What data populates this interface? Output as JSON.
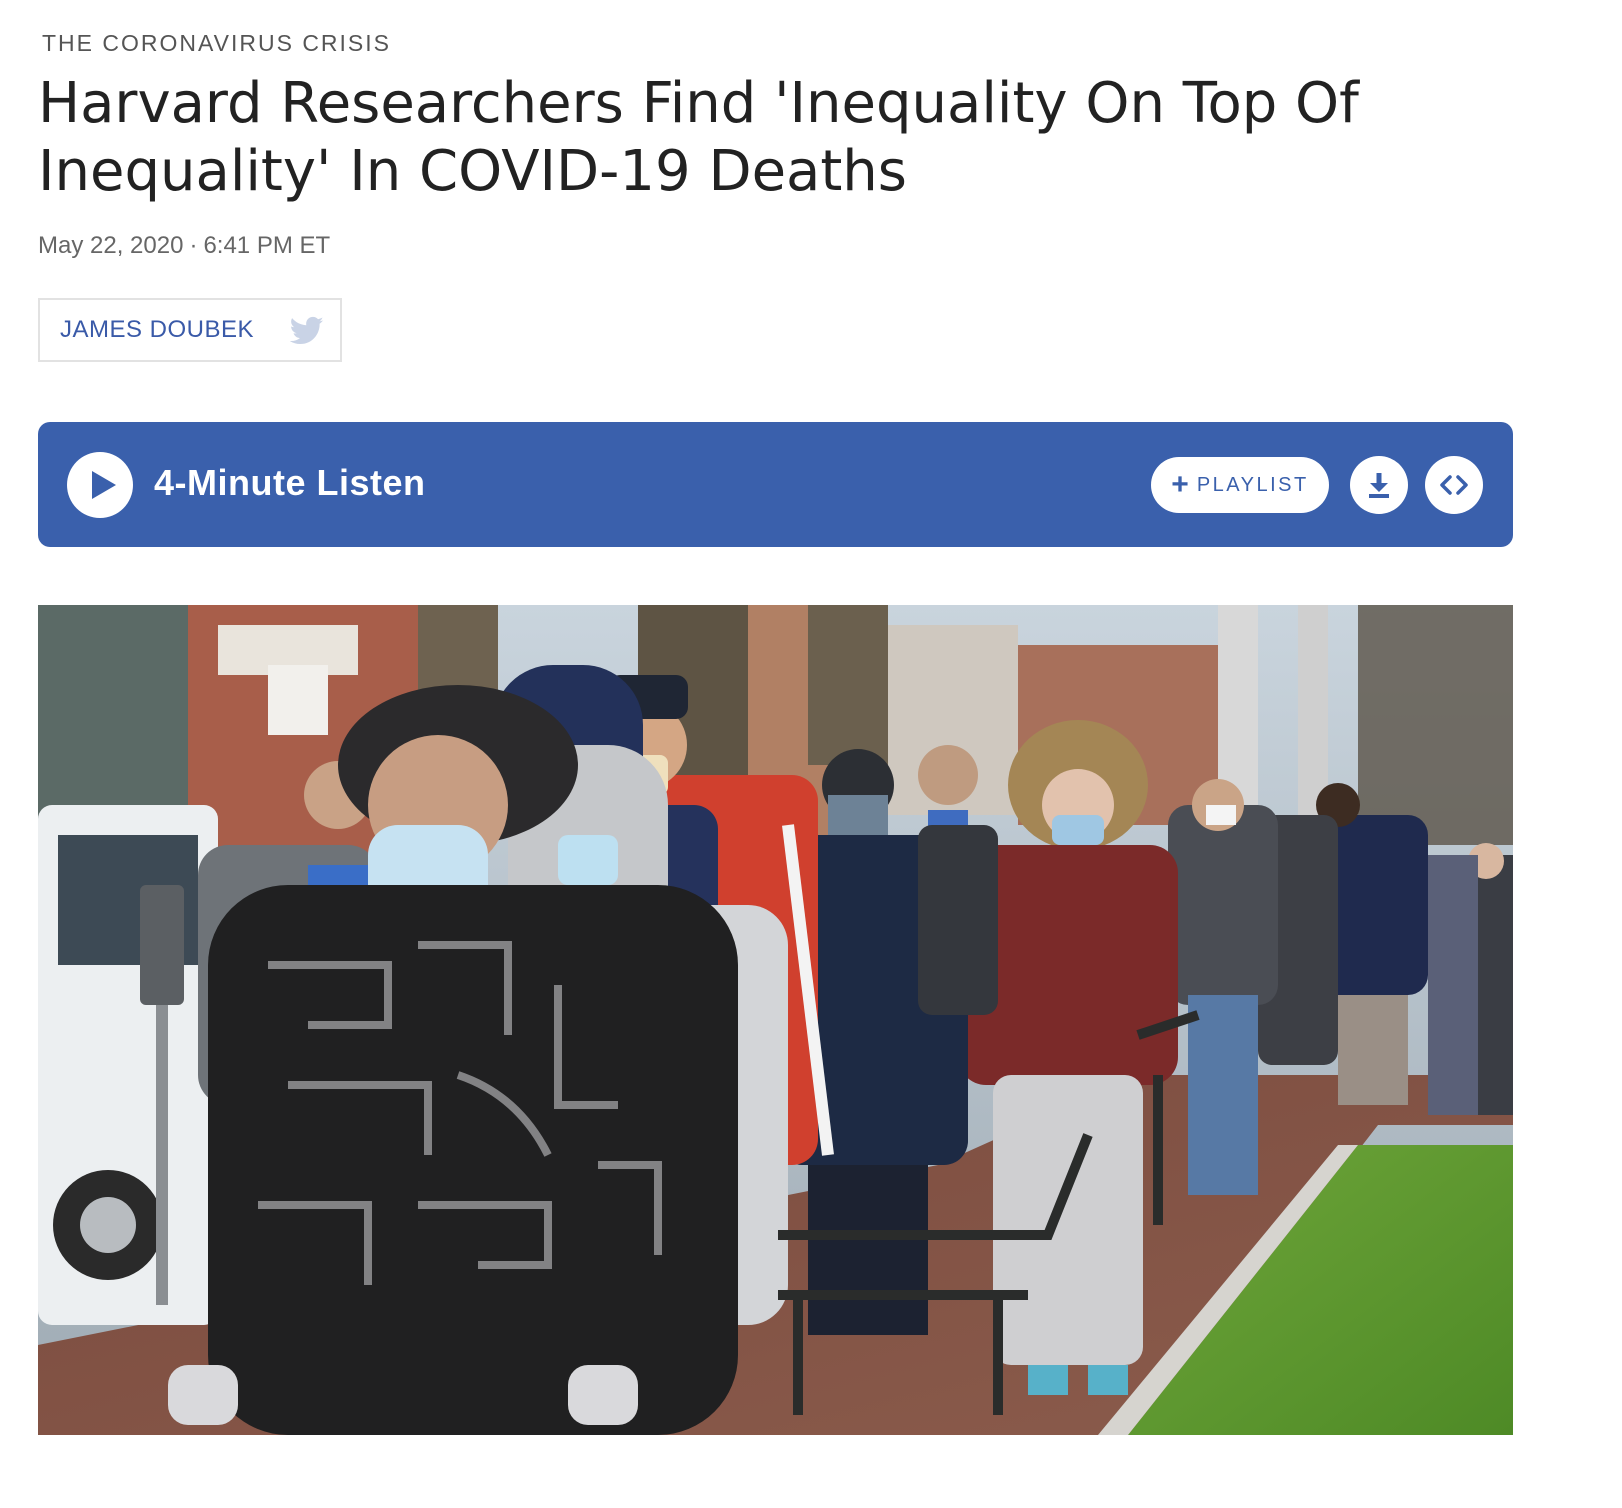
{
  "article": {
    "section": "THE CORONAVIRUS CRISIS",
    "headline_line1": "Harvard Researchers Find 'Inequality On Top Of",
    "headline_line2": "Inequality' In COVID-19 Deaths",
    "date": "May 22, 2020",
    "date_separator": "·",
    "time": "6:41 PM ET"
  },
  "byline": {
    "author": "JAMES DOUBEK",
    "icon": "twitter-icon"
  },
  "player": {
    "title": "4-Minute Listen",
    "playlist_label": "PLAYLIST",
    "playlist_icon": "plus-icon",
    "download_icon": "download-icon",
    "embed_icon": "embed-icon",
    "accent_color": "#3a60ac"
  },
  "photo": {
    "subject": "photo"
  }
}
